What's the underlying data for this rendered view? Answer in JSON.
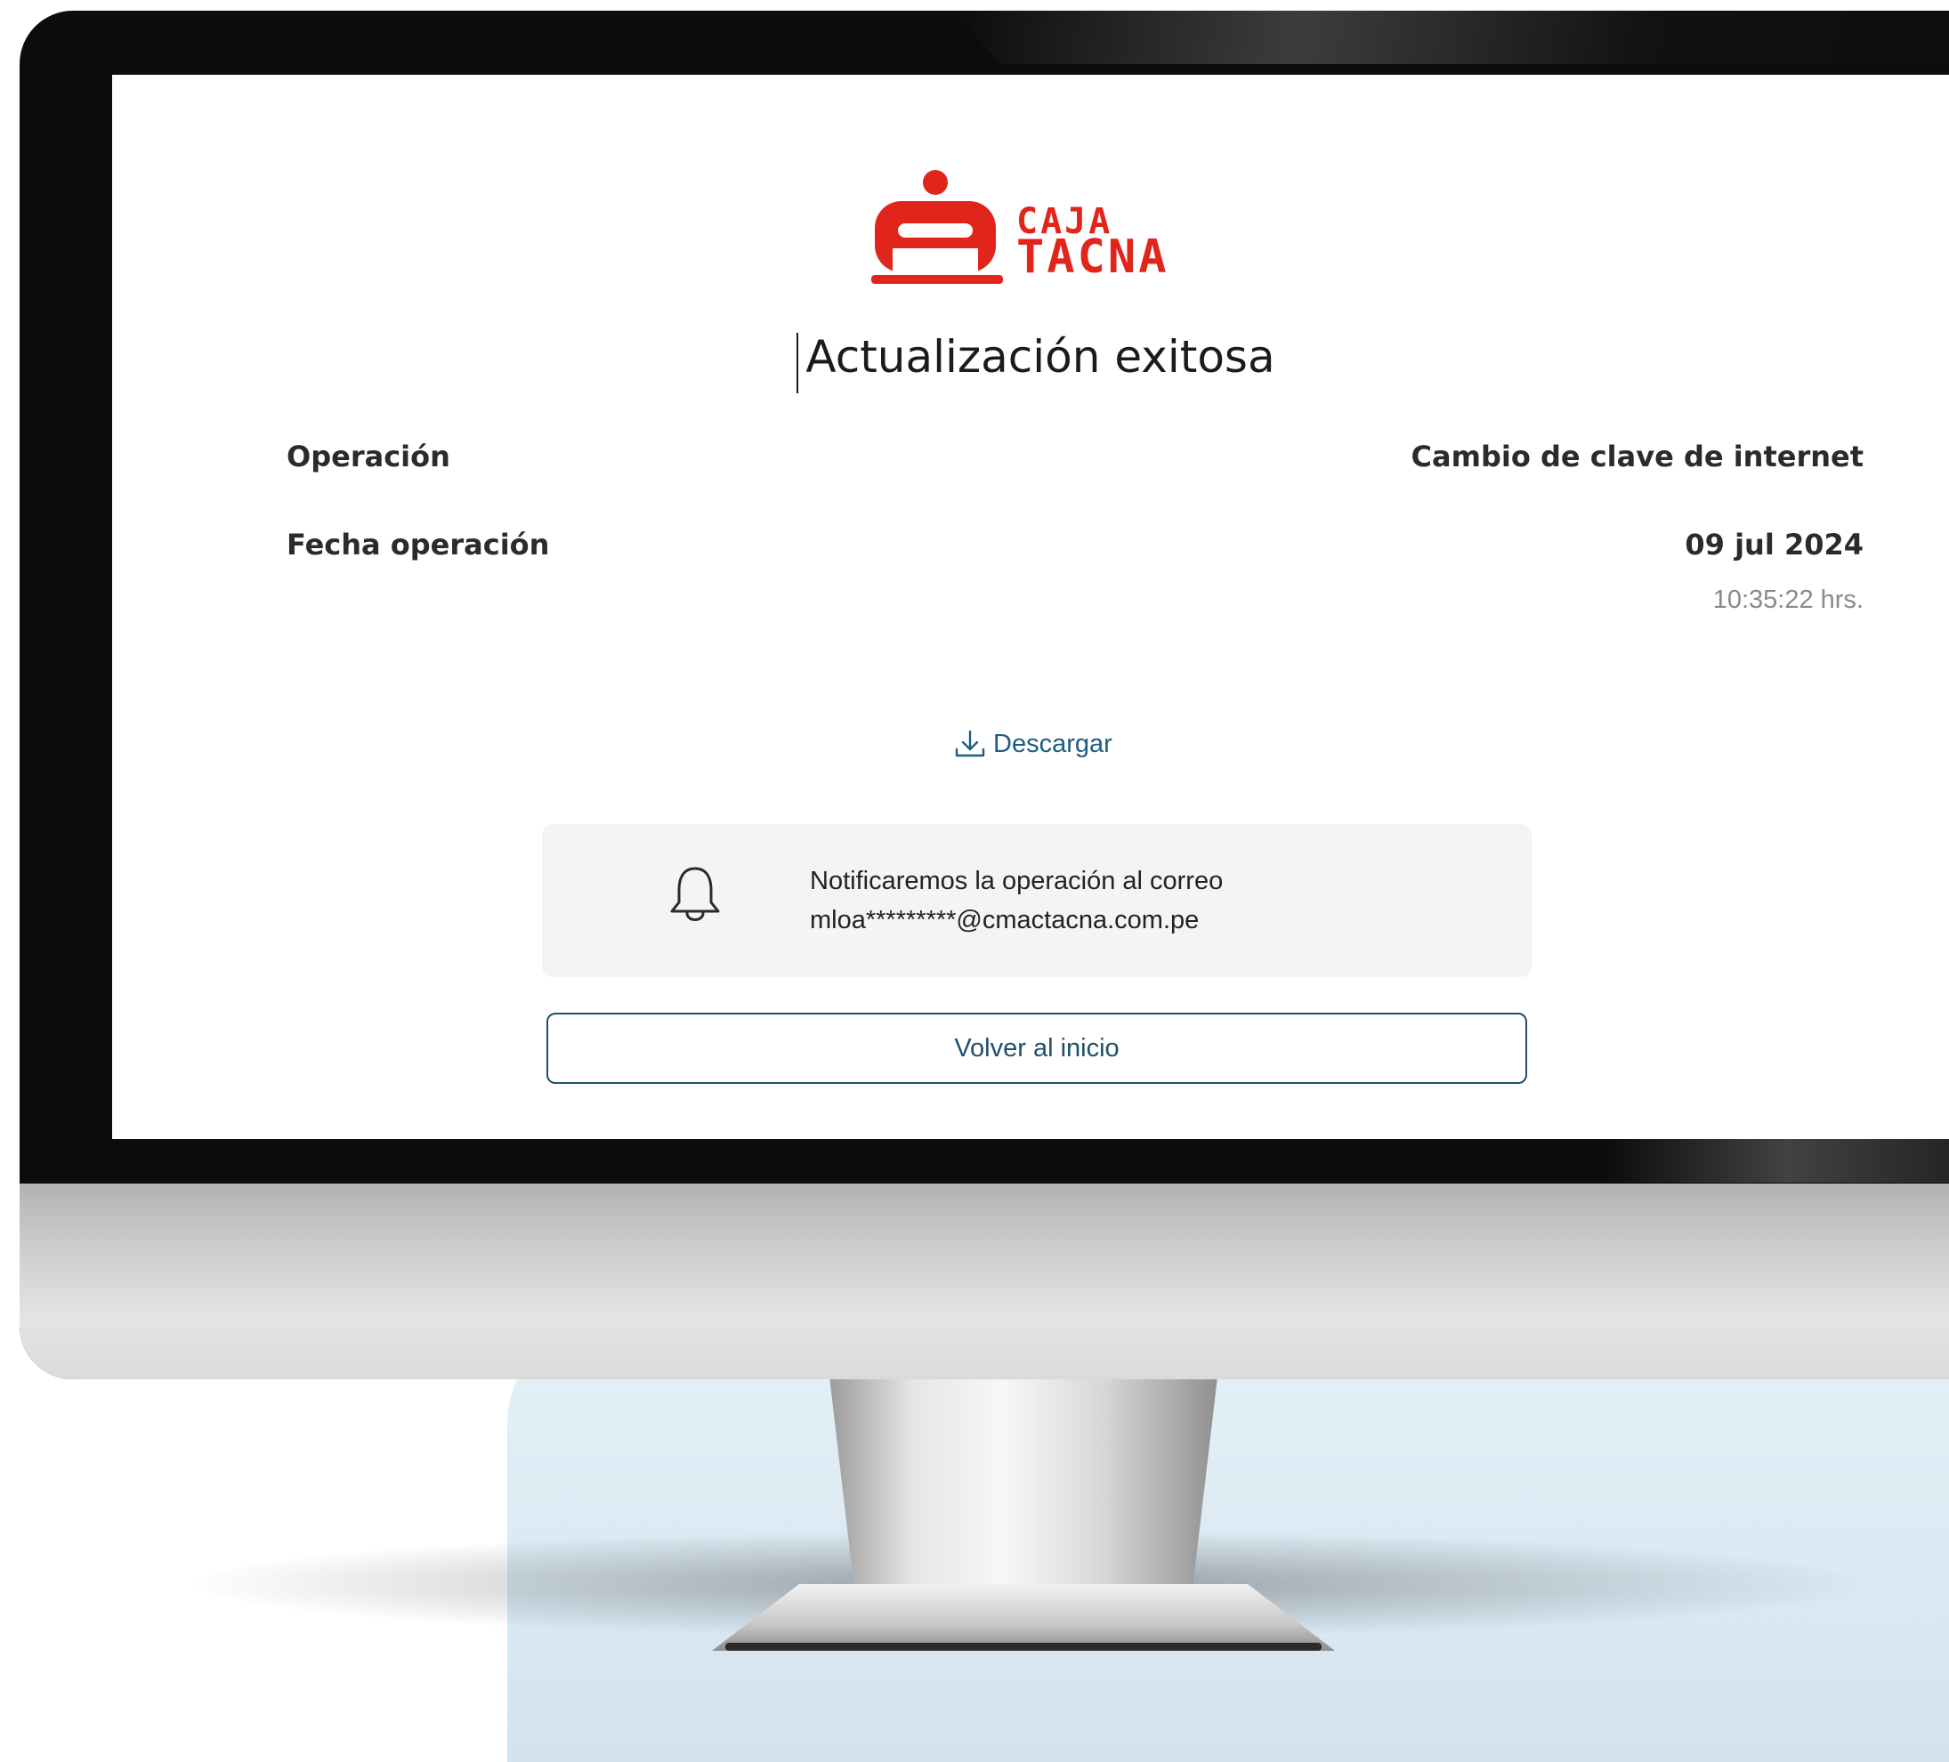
{
  "brand": {
    "name_line_1": "CAJA",
    "name_line_2": "TACNA",
    "color": "#e1251b"
  },
  "page": {
    "title": "Actualización exitosa"
  },
  "details": {
    "operation_label": "Operación",
    "operation_value": "Cambio de clave de internet",
    "date_label": "Fecha operación",
    "date_value": "09 jul 2024",
    "time_value": "10:35:22 hrs."
  },
  "download": {
    "label": "Descargar",
    "icon": "download-icon",
    "color": "#1c5d82"
  },
  "notice": {
    "icon": "bell-icon",
    "line_1": "Notificaremos la operación al correo",
    "line_2": "mloa*********@cmactacna.com.pe"
  },
  "actions": {
    "back_label": "Volver al inicio",
    "border_color": "#1f4f6a"
  }
}
